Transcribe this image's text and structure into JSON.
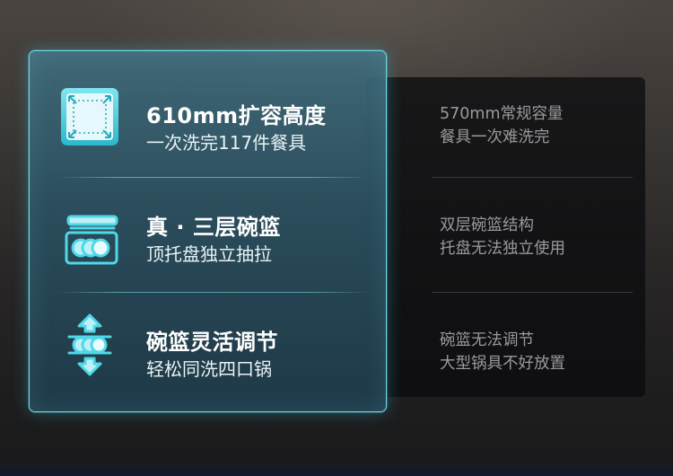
{
  "colors": {
    "accent": "#4fd8e8",
    "card_border": "#6fd6e6",
    "muted_text": "#9a9a9c"
  },
  "features": [
    {
      "icon": "expand-box-icon",
      "title": "610mm扩容高度",
      "subtitle": "一次洗完117件餐具"
    },
    {
      "icon": "three-layer-rack-icon",
      "title": "真 · 三层碗篮",
      "subtitle": "顶托盘独立抽拉"
    },
    {
      "icon": "adjustable-rack-icon",
      "title": "碗篮灵活调节",
      "subtitle": "轻松同洗四口锅"
    }
  ],
  "comparison": [
    {
      "line1": "570mm常规容量",
      "line2": "餐具一次难洗完"
    },
    {
      "line1": "双层碗篮结构",
      "line2": "托盘无法独立使用"
    },
    {
      "line1": "碗篮无法调节",
      "line2": "大型锅具不好放置"
    }
  ]
}
